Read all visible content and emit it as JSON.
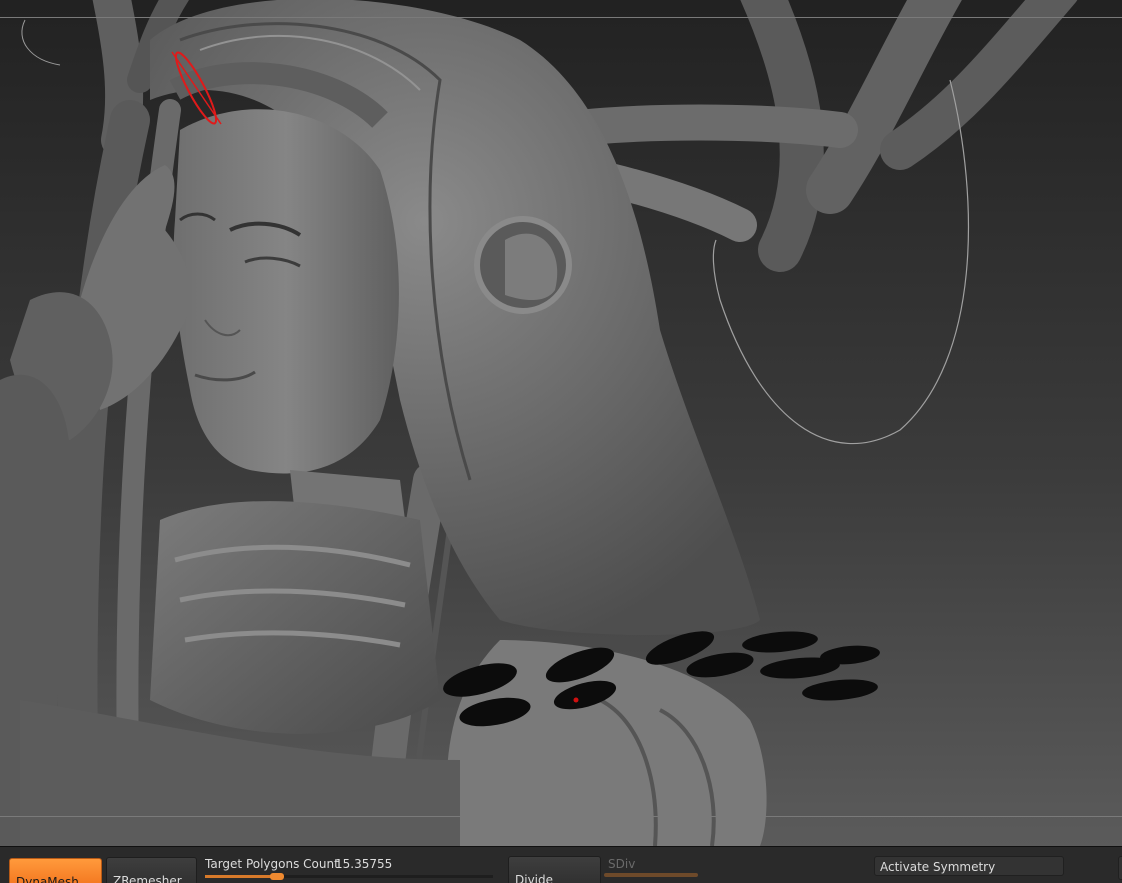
{
  "bottom_toolbar": {
    "dynamesh_label": "DynaMesh",
    "zremesher_label": "ZRemesher",
    "target_polygons_label": "Target Polygons Count",
    "target_polygons_value": "15.35755",
    "divide_label": "Divide",
    "sdiv_label": "SDiv",
    "activate_symmetry_label": "Activate Symmetry"
  },
  "colors": {
    "accent_orange": "#f3751e",
    "panel_bg": "#2a2a2a",
    "viewport_top": "#222222",
    "viewport_bottom": "#5b5b5b",
    "clay": "#6e6e6e"
  },
  "icons": {
    "brush_cursor": "brush-stroke-cursor-icon"
  }
}
